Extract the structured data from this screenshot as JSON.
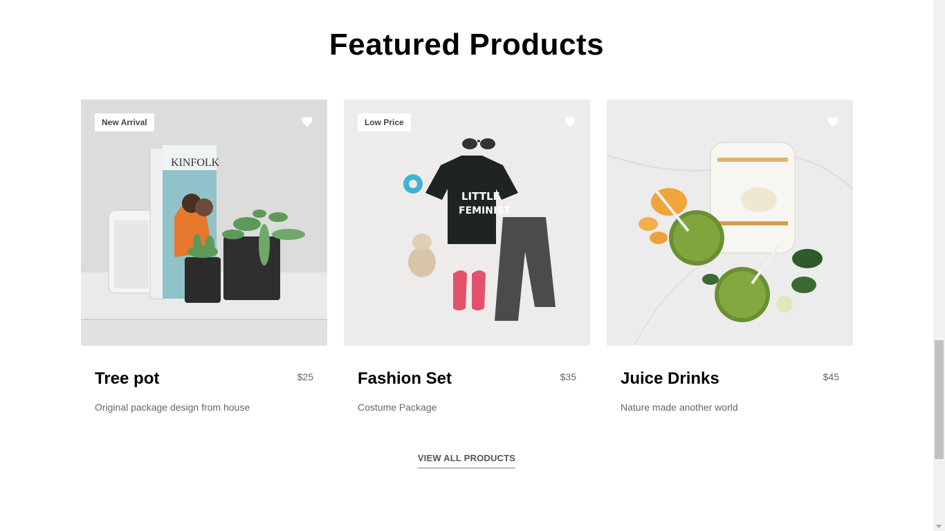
{
  "section": {
    "title": "Featured Products"
  },
  "products": [
    {
      "name": "Tree pot",
      "price": "$25",
      "description": "Original package design from house",
      "badge": "New Arrival",
      "image": "plant-shelf-image"
    },
    {
      "name": "Fashion Set",
      "price": "$35",
      "description": "Costume Package",
      "badge": "Low Price",
      "image": "kids-outfit-image"
    },
    {
      "name": "Juice Drinks",
      "price": "$45",
      "description": "Nature made another world",
      "badge": "",
      "image": "green-smoothie-image"
    }
  ],
  "icons": {
    "favorite": "heart-icon"
  },
  "view_all": {
    "label": "VIEW ALL PRODUCTS"
  },
  "colors": {
    "title": "#000000",
    "muted": "#666666",
    "badge_bg": "#ffffff",
    "underline": "#bbbbbb"
  }
}
